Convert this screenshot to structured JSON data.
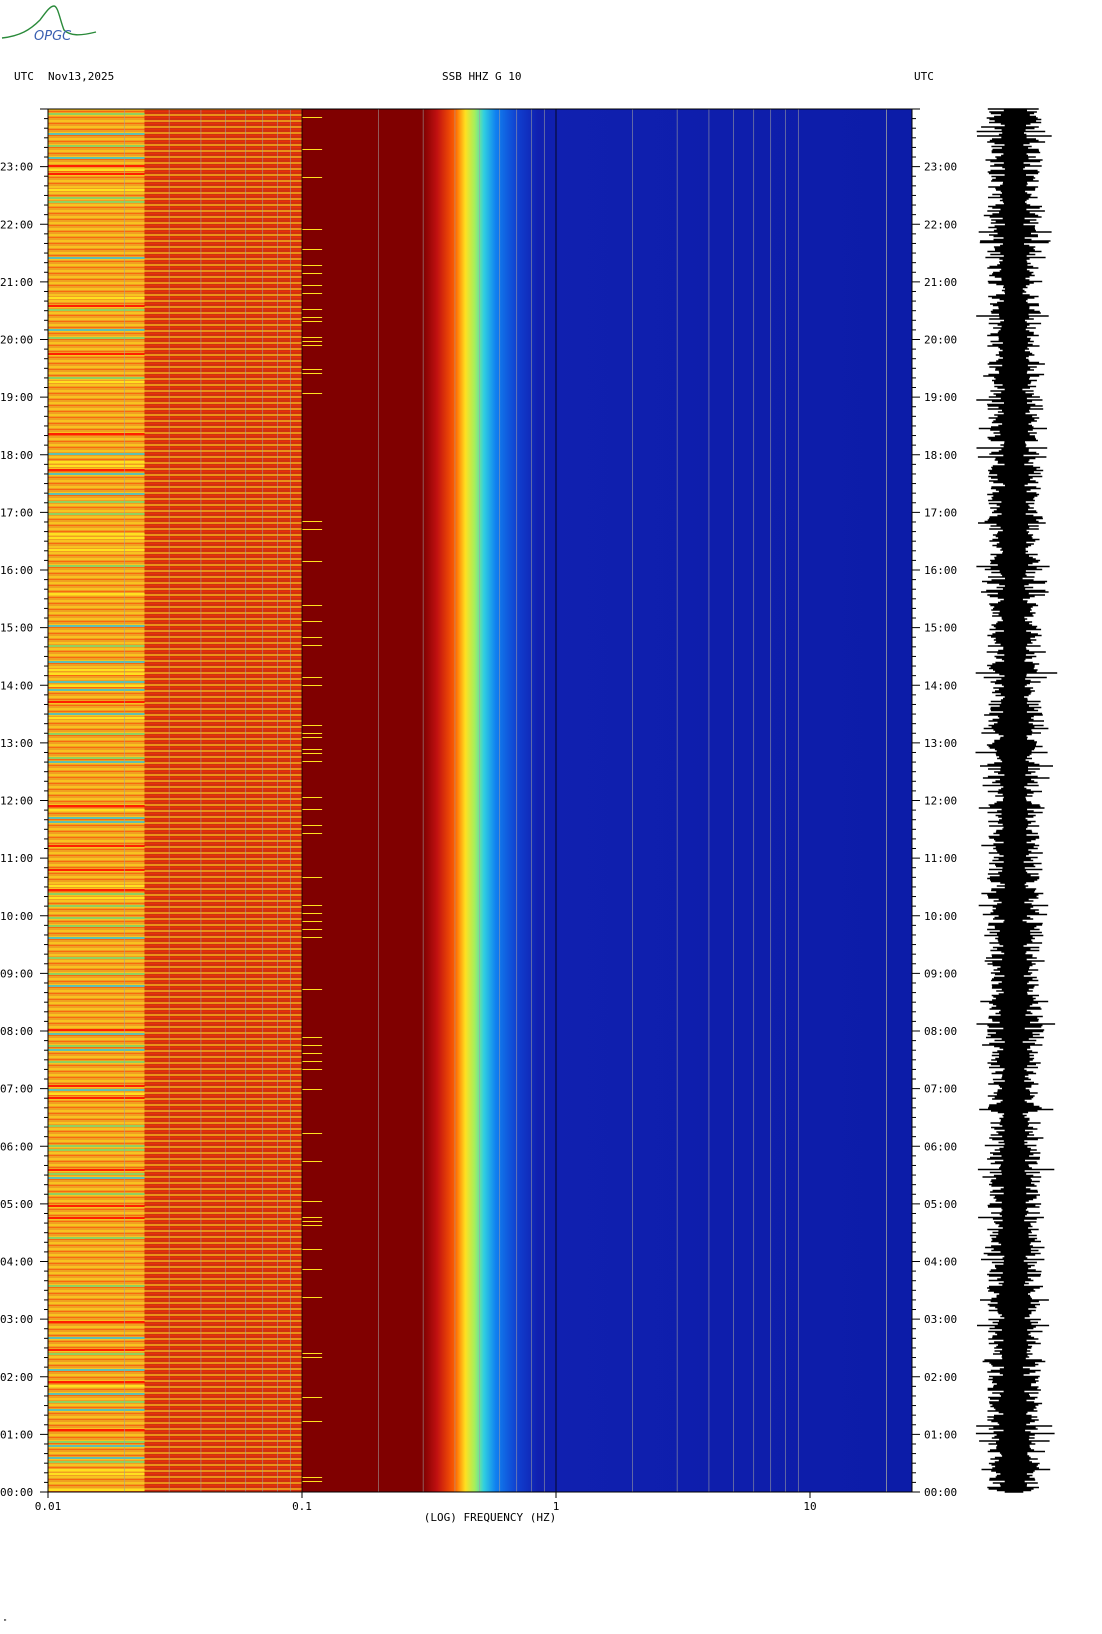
{
  "header": {
    "left_tz": "UTC",
    "date": "Nov13,2025",
    "station": "SSB HHZ G 10",
    "right_tz": "UTC"
  },
  "logo": {
    "text": "OPGC",
    "color": "#2a8a3a",
    "text_color": "#3a5fb0"
  },
  "chart_data": {
    "type": "heatmap",
    "title": "SSB HHZ G 10",
    "xlabel": "(LOG) FREQUENCY (HZ)",
    "x_scale": "log",
    "xlim": [
      0.01,
      25
    ],
    "x_ticks": [
      {
        "value": 0.01,
        "label": "0.01"
      },
      {
        "value": 0.1,
        "label": "0.1"
      },
      {
        "value": 1,
        "label": "1"
      },
      {
        "value": 10,
        "label": "10"
      }
    ],
    "ylim_hours": [
      0,
      24
    ],
    "y_ticks": [
      {
        "value": 0,
        "label": "00:00"
      },
      {
        "value": 1,
        "label": "01:00"
      },
      {
        "value": 2,
        "label": "02:00"
      },
      {
        "value": 3,
        "label": "03:00"
      },
      {
        "value": 4,
        "label": "04:00"
      },
      {
        "value": 5,
        "label": "05:00"
      },
      {
        "value": 6,
        "label": "06:00"
      },
      {
        "value": 7,
        "label": "07:00"
      },
      {
        "value": 8,
        "label": "08:00"
      },
      {
        "value": 9,
        "label": "09:00"
      },
      {
        "value": 10,
        "label": "10:00"
      },
      {
        "value": 11,
        "label": "11:00"
      },
      {
        "value": 12,
        "label": "12:00"
      },
      {
        "value": 13,
        "label": "13:00"
      },
      {
        "value": 14,
        "label": "14:00"
      },
      {
        "value": 15,
        "label": "15:00"
      },
      {
        "value": 16,
        "label": "16:00"
      },
      {
        "value": 17,
        "label": "17:00"
      },
      {
        "value": 18,
        "label": "18:00"
      },
      {
        "value": 19,
        "label": "19:00"
      },
      {
        "value": 20,
        "label": "20:00"
      },
      {
        "value": 21,
        "label": "21:00"
      },
      {
        "value": 22,
        "label": "22:00"
      },
      {
        "value": 23,
        "label": "23:00"
      }
    ],
    "color_bands": [
      {
        "from_hz": 0.01,
        "to_hz": 0.024,
        "color": "#f0a020"
      },
      {
        "from_hz": 0.024,
        "to_hz": 0.1,
        "color": "#d03010"
      },
      {
        "from_hz": 0.1,
        "to_hz": 0.3,
        "color": "#800000"
      },
      {
        "from_hz": 0.3,
        "to_hz": 0.75,
        "color": "#30c0d0"
      },
      {
        "from_hz": 0.75,
        "to_hz": 25,
        "color": "#1020b0"
      }
    ],
    "grid": true
  },
  "footer_mark": "\""
}
